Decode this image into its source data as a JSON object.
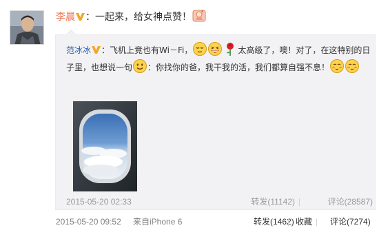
{
  "post": {
    "author": "李晨",
    "text": "：一起来，给女神点赞！",
    "avatar_icon": "avatar-photo",
    "vip_icon": "vip-v-badge",
    "emoji_icon": "thumbs-up-emoji",
    "time": "2015-05-20 09:52",
    "source_prefix": "来自",
    "source": "iPhone 6",
    "forward_label": "转发(1462)",
    "favorite_label": "收藏",
    "comment_label": "评论(7274)"
  },
  "repost": {
    "author": "范冰冰",
    "text_a": "：飞机上竟也有Wi－Fi，",
    "text_b": "太高级了，噢！对了，在这特别的日子里，也想说一句",
    "text_c": "：你找你的爸，我干我的活，我们都算自强不息！",
    "emoji_icons": [
      "relieved-face-emoji",
      "grinning-face-emoji",
      "rose-emoji",
      "smiling-face-emoji",
      "shy-face-emoji",
      "shy-face-emoji"
    ],
    "photo_icon": "airplane-window-photo",
    "time": "2015-05-20 02:33",
    "forward_label": "转发(11142)",
    "separator": "|",
    "comment_label": "评论(28587)"
  },
  "colors": {
    "author_link": "#eb7350",
    "orig_author_link": "#2a5ea8",
    "repost_bg": "#f2f2f5",
    "meta_gray": "#9b9b9b",
    "vip_orange": "#f5a623"
  }
}
